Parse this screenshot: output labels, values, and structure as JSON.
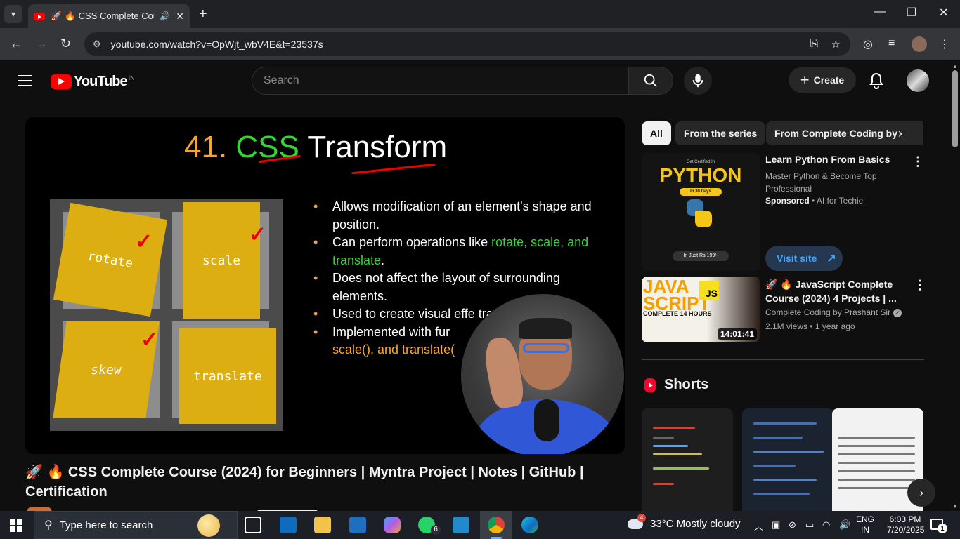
{
  "browser": {
    "tab_title": "🚀 🔥 CSS Complete Course",
    "url": "youtube.com/watch?v=OpWjt_wbV4E&t=23537s"
  },
  "youtube": {
    "logo_text": "YouTube",
    "country_code": "IN",
    "search_placeholder": "Search",
    "create_label": "Create"
  },
  "video_slide": {
    "title_number": "41.",
    "title_css": "CSS",
    "title_rest": "Transform",
    "cards": [
      "rotate",
      "scale",
      "skew",
      "translate"
    ],
    "bullets": {
      "b1": "Allows modification of an element's shape and position.",
      "b2_prefix": "Can perform operations like ",
      "b2_highlight": "rotate, scale, and translate",
      "b2_suffix": ".",
      "b3": "Does not affect the layout of surrounding elements.",
      "b4": "Used to create visual effe transformations.",
      "b5_prefix": "Implemented with fur",
      "b5_highlight": "scale(), and translate("
    },
    "presenter_icon": "person-video-overlay"
  },
  "video": {
    "title": "🚀 🔥 CSS Complete Course (2024) for Beginners | Myntra Project | Notes | GitHub | Certification"
  },
  "sidebar": {
    "chips": [
      "All",
      "From the series",
      "From Complete Coding by"
    ],
    "ad": {
      "thumb_top": "Get Certified In",
      "thumb_title": "PYTHON",
      "thumb_days": "In 30 Days",
      "thumb_price": "In Just Rs 199/-",
      "title": "Learn Python From Basics",
      "description": "Master Python & Become Top Professional",
      "sponsored": "Sponsored",
      "advertiser": " • AI for Techie",
      "visit_label": "Visit site"
    },
    "related": {
      "thumb_java": "JAVA",
      "thumb_script": "SCRIPT",
      "thumb_complete": "COMPLETE 14 HOURS",
      "thumb_js": "JS",
      "duration": "14:01:41",
      "title": "🚀 🔥 JavaScript Complete Course (2024) 4 Projects | ...",
      "channel": "Complete Coding by Prashant Sir",
      "meta": "2.1M views • 1 year ago"
    },
    "shorts_title": "Shorts"
  },
  "taskbar": {
    "search_placeholder": "Type here to search",
    "whatsapp_badge": "6",
    "weather_badge": "4",
    "weather": "33°C  Mostly cloudy",
    "lang_top": "ENG",
    "lang_bottom": "IN",
    "time": "6:03 PM",
    "date": "7/20/2025",
    "notif_count": "1"
  },
  "colors": {
    "yt_red": "#ff0000",
    "slide_orange": "#f6a72b",
    "slide_green": "#33d633",
    "card_gold": "#dcae11",
    "link_blue": "#3ea6ff"
  }
}
